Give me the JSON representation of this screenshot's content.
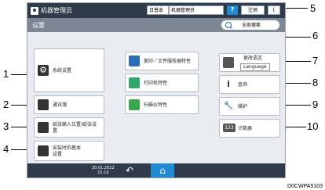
{
  "topbar": {
    "user_name": "机器管理员",
    "chip_left": "日普本",
    "chip_right": "机器管理员",
    "help": "?",
    "logout": "注销",
    "energy": "("
  },
  "title": {
    "text": "设置",
    "search_label": "全部搜索"
  },
  "left_tiles": [
    {
      "label": "系统设置"
    },
    {
      "label": "通讯簿"
    },
    {
      "label": "纸张输入位置/纸张设置"
    },
    {
      "label": "安装时的基本设置"
    }
  ],
  "middle_tiles": [
    {
      "label": "复印／文件服务器特性"
    },
    {
      "label": "打印机特性"
    },
    {
      "label": "扫描仪特性"
    }
  ],
  "right_tiles": [
    {
      "label_line1": "更改语言",
      "label_line2": "Language"
    },
    {
      "label": "查询"
    },
    {
      "label": "维护"
    },
    {
      "label": "计数器",
      "icon_text": "123"
    }
  ],
  "bottombar": {
    "date": "20.01.2022",
    "time": "15:10"
  },
  "callouts": [
    "1",
    "2",
    "3",
    "4",
    "5",
    "6",
    "7",
    "8",
    "9",
    "10"
  ],
  "caption": "D0CWPA5103",
  "colors": {
    "topbar": "#2f3a4a",
    "title": "#7c8694",
    "accent": "#1e8bd6"
  }
}
